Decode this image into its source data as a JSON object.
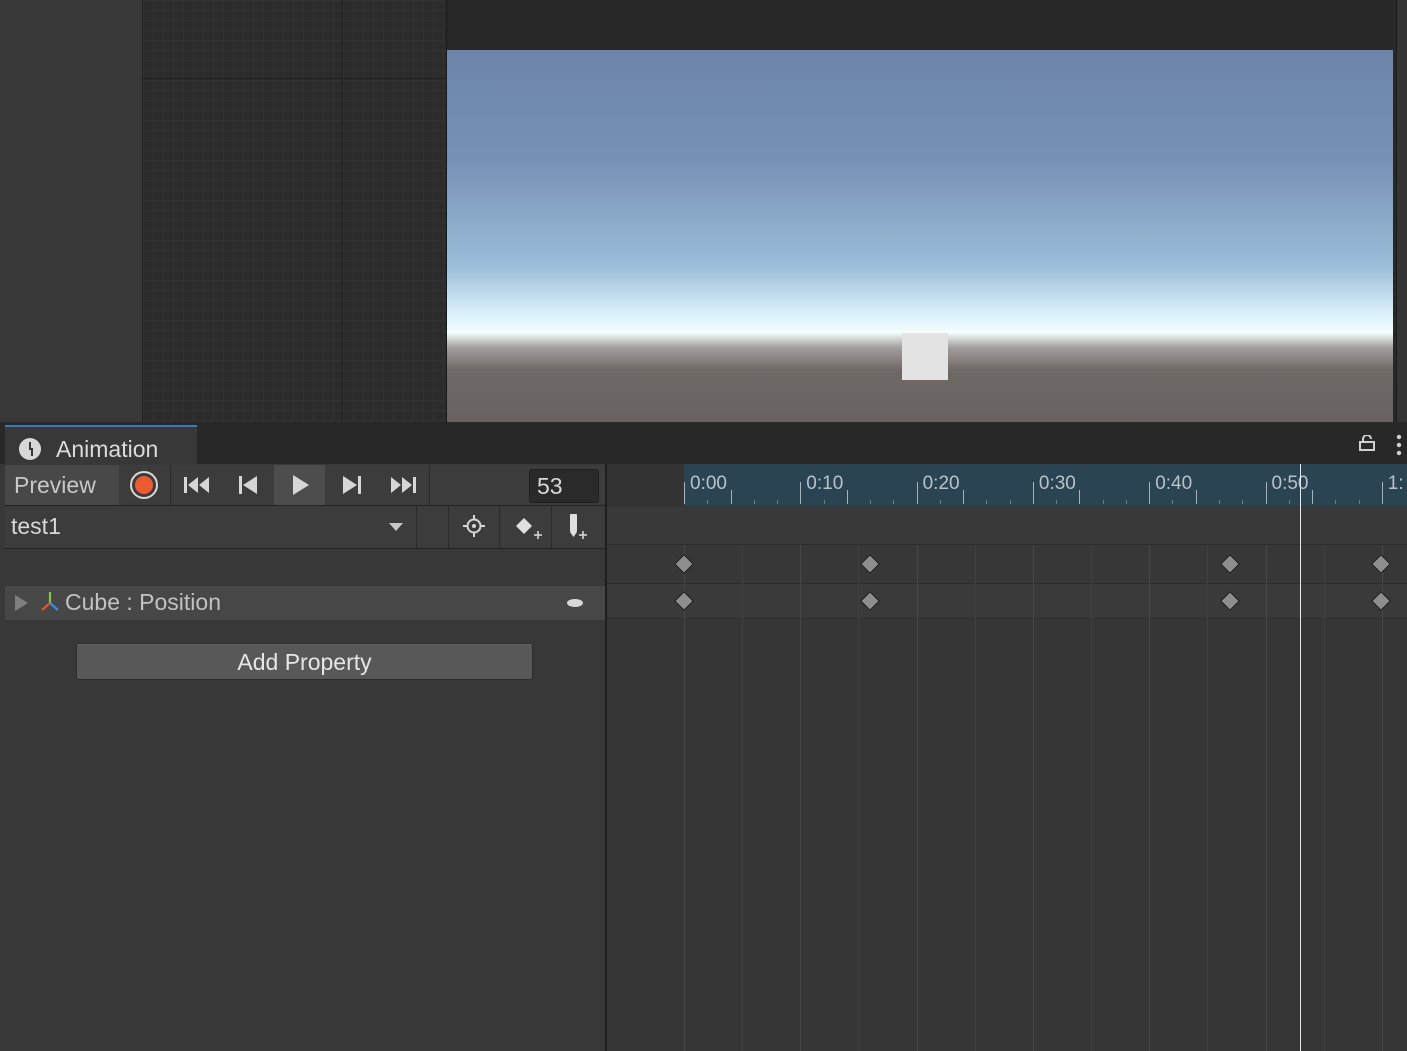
{
  "window": {
    "tab_title": "Animation",
    "icons": {
      "tab": "clock-icon",
      "lock": "lock-icon",
      "menu": "kebab-menu-icon"
    }
  },
  "toolbar": {
    "preview_label": "Preview",
    "record": "record-icon",
    "first_key": "skip-to-start-icon",
    "prev_key": "previous-keyframe-icon",
    "play": "play-icon",
    "next_key": "next-keyframe-icon",
    "last_key": "skip-to-end-icon",
    "frame": "53",
    "record_color": "#ee5b33"
  },
  "clip": {
    "name": "test1",
    "icons": {
      "crosshair": "crosshair-icon",
      "add_keyframe": "add-keyframe-icon",
      "add_event": "add-event-icon"
    }
  },
  "properties": [
    {
      "label": "Cube : Position",
      "icon": "transform-axes-icon"
    }
  ],
  "add_property_label": "Add Property",
  "timeline": {
    "ruler_labels": [
      "0:00",
      "0:10",
      "0:20",
      "0:30",
      "0:40",
      "0:50",
      "1:"
    ],
    "keyframe_times": [
      "0:00",
      "0:16",
      "0:47",
      "1:00"
    ],
    "current_frame": "53",
    "accent": "#3a79bb",
    "ruler_bg": "#2b4453"
  }
}
